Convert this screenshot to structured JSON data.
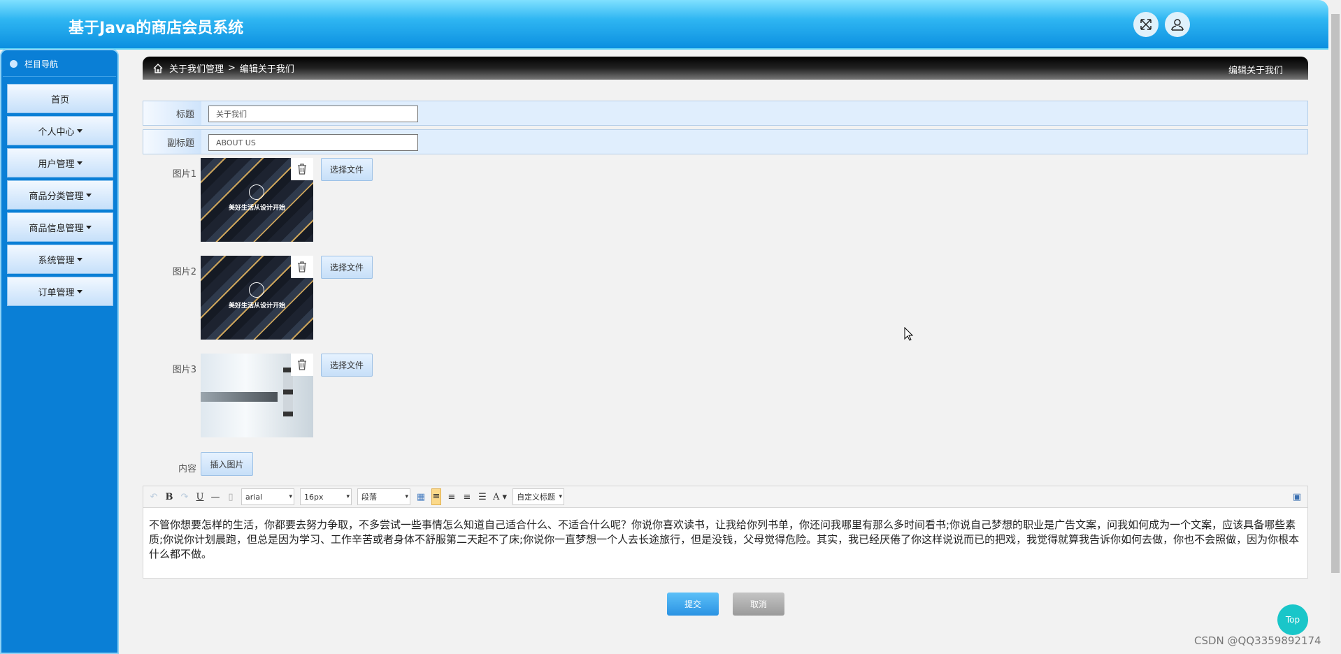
{
  "header": {
    "title": "基于Java的商店会员系统",
    "icons": [
      "fullscreen-icon",
      "user-icon"
    ]
  },
  "sidebar": {
    "heading": "栏目导航",
    "items": [
      {
        "label": "首页",
        "dropdown": false
      },
      {
        "label": "个人中心",
        "dropdown": true
      },
      {
        "label": "用户管理",
        "dropdown": true
      },
      {
        "label": "商品分类管理",
        "dropdown": true
      },
      {
        "label": "商品信息管理",
        "dropdown": true
      },
      {
        "label": "系统管理",
        "dropdown": true
      },
      {
        "label": "订单管理",
        "dropdown": true
      }
    ]
  },
  "breadcrumb": {
    "parent": "关于我们管理",
    "separator": ">",
    "current": "编辑关于我们",
    "right_title": "编辑关于我们"
  },
  "form": {
    "title_label": "标题",
    "title_value": "关于我们",
    "subtitle_label": "副标题",
    "subtitle_value": "ABOUT US",
    "images": [
      {
        "label": "图片1",
        "overlay": "美好生活从设计开始"
      },
      {
        "label": "图片2",
        "overlay": "美好生活从设计开始"
      },
      {
        "label": "图片3",
        "overlay": ""
      }
    ],
    "choose_file": "选择文件",
    "content_label": "内容",
    "insert_image": "插入图片"
  },
  "editor": {
    "toolbar": {
      "font": "arial",
      "size": "16px",
      "paragraph": "段落",
      "custom_heading": "自定义标题",
      "bold": "B",
      "underline": "U",
      "font_color": "A"
    },
    "content": "不管你想要怎样的生活，你都要去努力争取，不多尝试一些事情怎么知道自己适合什么、不适合什么呢？你说你喜欢读书，让我给你列书单，你还问我哪里有那么多时间看书;你说自己梦想的职业是广告文案，问我如何成为一个文案，应该具备哪些素质;你说你计划晨跑，但总是因为学习、工作辛苦或者身体不舒服第二天起不了床;你说你一直梦想一个人去长途旅行，但是没钱，父母觉得危险。其实，我已经厌倦了你这样说说而已的把戏，我觉得就算我告诉你如何去做，你也不会照做，因为你根本什么都不做。"
  },
  "actions": {
    "submit": "提交",
    "cancel": "取消",
    "top": "Top"
  },
  "watermark": "CSDN @QQ3359892174",
  "colors": {
    "header": "#0b8fe0",
    "sidebar": "#0a7fd6",
    "submit": "#3aa6ee",
    "cancel": "#a8a8a8",
    "top": "#19c6c9"
  }
}
